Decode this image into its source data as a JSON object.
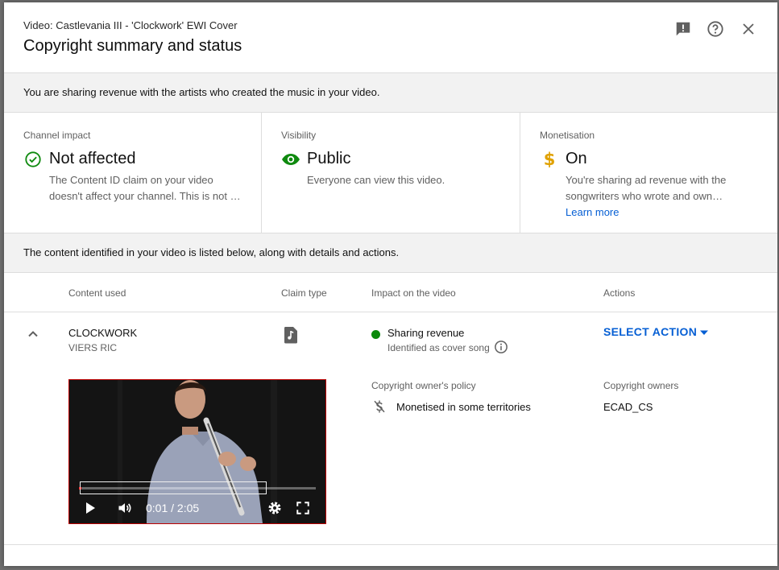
{
  "header": {
    "subtitle": "Video: Castlevania III - 'Clockwork' EWI Cover",
    "title": "Copyright summary and status"
  },
  "banner_top": "You are sharing revenue with the artists who created the music in your video.",
  "cards": {
    "channel": {
      "label": "Channel impact",
      "value": "Not affected",
      "desc_line1": "The Content ID claim on your video",
      "desc_line2": "doesn't affect your channel. This is not …"
    },
    "visibility": {
      "label": "Visibility",
      "value": "Public",
      "desc_line1": "Everyone can view this video."
    },
    "monetisation": {
      "label": "Monetisation",
      "value": "On",
      "desc_line1": "You're sharing ad revenue with the",
      "desc_line2": "songwriters who wrote and own…",
      "link": "Learn more"
    }
  },
  "banner_mid": "The content identified in your video is listed below, along with details and actions.",
  "table": {
    "headers": {
      "content": "Content used",
      "claim": "Claim type",
      "impact": "Impact on the video",
      "actions": "Actions"
    },
    "row": {
      "title": "CLOCKWORK",
      "artist": "VIERS RIC",
      "impact": "Sharing revenue",
      "impact_sub": "Identified as cover song",
      "action": "SELECT ACTION",
      "policy_label": "Copyright owner's policy",
      "policy_value": "Monetised in some territories",
      "owners_label": "Copyright owners",
      "owners_value": "ECAD_CS"
    }
  },
  "player": {
    "time": "0:01 / 2:05",
    "progress": 0.01
  },
  "colors": {
    "green": "#0f8a0f",
    "gold": "#e0a100",
    "link": "#065fd4",
    "status": "#0c8a0c"
  },
  "icons": [
    "feedback-icon",
    "help-icon",
    "close-icon",
    "check-circle-icon",
    "eye-icon",
    "dollar-icon",
    "chevron-up-icon",
    "music-note-icon",
    "info-icon",
    "caret-down-icon",
    "money-off-icon",
    "play-icon",
    "volume-icon",
    "settings-icon",
    "fullscreen-icon"
  ]
}
